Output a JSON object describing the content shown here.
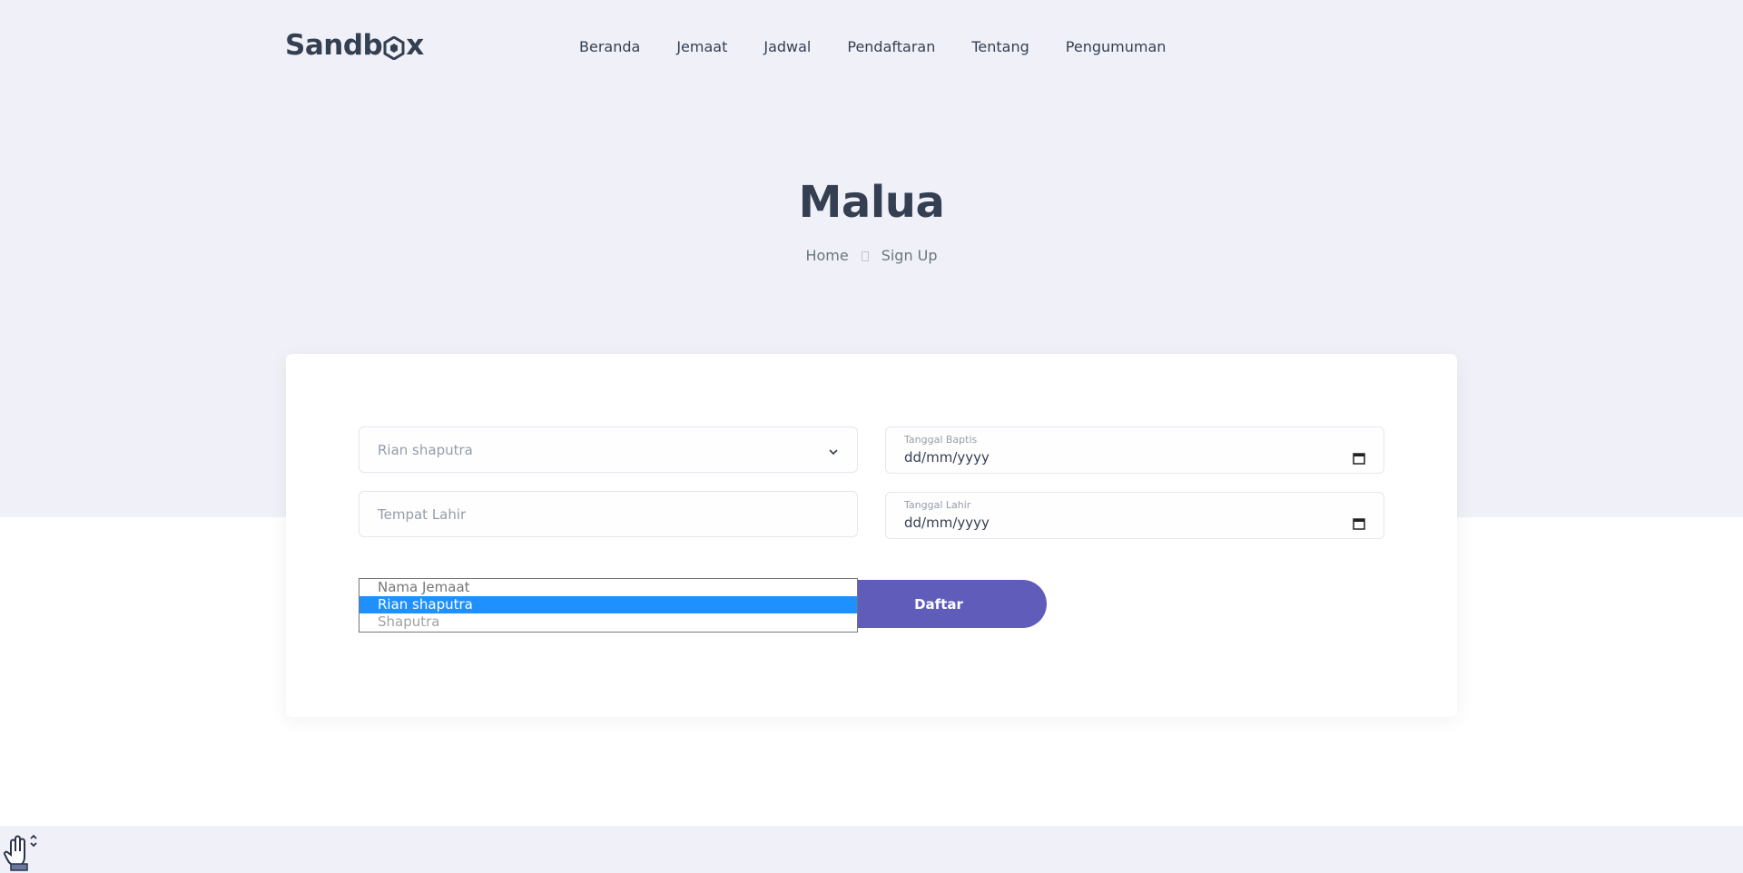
{
  "header": {
    "logo_text_start": "Sandb",
    "logo_text_end": "x",
    "nav": [
      "Beranda",
      "Jemaat",
      "Jadwal",
      "Pendaftaran",
      "Tentang",
      "Pengumuman"
    ]
  },
  "hero": {
    "title": "Malua",
    "breadcrumb": [
      "Home",
      "Sign Up"
    ]
  },
  "form": {
    "select_value": "Rian shaputra",
    "tempat_lahir_placeholder": "Tempat Lahir",
    "tanggal_baptis_label": "Tanggal Baptis",
    "tanggal_baptis_value": "dd/mm/yyyy",
    "tanggal_lahir_label": "Tanggal Lahir",
    "tanggal_lahir_value": "dd/mm/yyyy",
    "submit_label": "Daftar",
    "dropdown_options": [
      "Nama Jemaat",
      "Rian shaputra",
      "Shaputra"
    ],
    "dropdown_selected": "Rian shaputra"
  },
  "colors": {
    "hero_bg": "#f0f1f8",
    "text_dark": "#343f52",
    "button": "#605dba",
    "option_highlight": "#1e90ff"
  },
  "icons": {
    "select_chevron": "chevron-down-icon",
    "date_picker": "calendar-icon",
    "cursor": "hand-scroll-icon"
  }
}
